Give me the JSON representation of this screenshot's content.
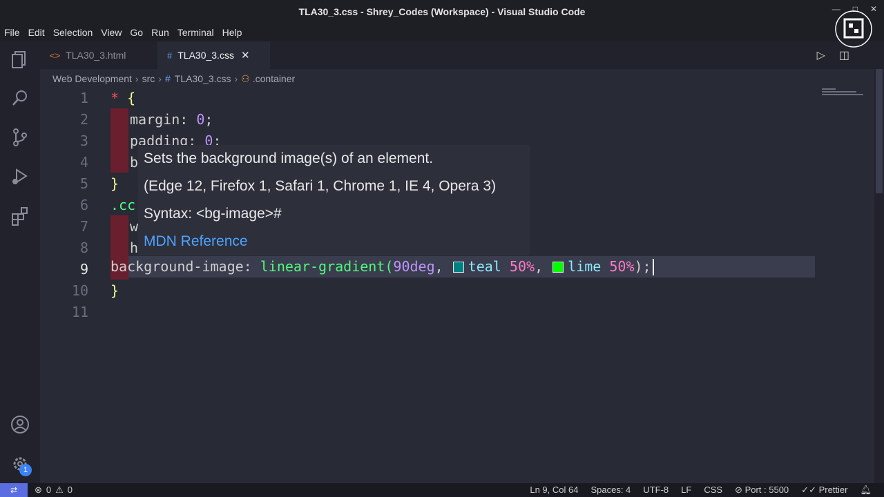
{
  "window": {
    "title": "TLA30_3.css - Shrey_Codes (Workspace) - Visual Studio Code",
    "controls": [
      "—",
      "□",
      "✕"
    ]
  },
  "menu": [
    "File",
    "Edit",
    "Selection",
    "View",
    "Go",
    "Run",
    "Terminal",
    "Help"
  ],
  "tabs": [
    {
      "label": "TLA30_3.html",
      "icon": "html-file-icon",
      "glyph": "<>",
      "active": false
    },
    {
      "label": "TLA30_3.css",
      "icon": "css-file-icon",
      "glyph": "#",
      "active": true
    }
  ],
  "breadcrumb": {
    "parts": [
      "Web Development",
      "src",
      "TLA30_3.css",
      ".container"
    ]
  },
  "editor": {
    "lines": [
      {
        "n": "1",
        "tokens": [
          {
            "t": "* ",
            "c": "kw-sel"
          },
          {
            "t": "{",
            "c": "brace"
          }
        ]
      },
      {
        "n": "2",
        "tokens": [
          {
            "t": "margin: ",
            "c": "prop"
          },
          {
            "t": "0",
            "c": "num"
          },
          {
            "t": ";",
            "c": "prop"
          }
        ]
      },
      {
        "n": "3",
        "tokens": [
          {
            "t": "padding: ",
            "c": "prop"
          },
          {
            "t": "0",
            "c": "num"
          },
          {
            "t": ";",
            "c": "prop"
          }
        ]
      },
      {
        "n": "4",
        "tokens": [
          {
            "t": "b",
            "c": "prop"
          }
        ]
      },
      {
        "n": "5",
        "tokens": [
          {
            "t": "}",
            "c": "brace"
          }
        ]
      },
      {
        "n": "6",
        "tokens": [
          {
            "t": ".cc",
            "c": "fn"
          }
        ]
      },
      {
        "n": "7",
        "tokens": [
          {
            "t": "w",
            "c": "prop"
          }
        ]
      },
      {
        "n": "8",
        "tokens": [
          {
            "t": "h",
            "c": "prop"
          }
        ]
      },
      {
        "n": "9",
        "tokens": []
      },
      {
        "n": "10",
        "tokens": [
          {
            "t": "}",
            "c": "brace"
          }
        ]
      },
      {
        "n": "11",
        "tokens": []
      }
    ],
    "line9": {
      "prop": "background-image: ",
      "fn": "linear-gradient(",
      "arg": "90deg",
      "comma1": ", ",
      "c1": "teal",
      "p1": " 50%",
      "comma2": ", ",
      "c2": "lime",
      "p2": " 50%",
      "end": ");"
    },
    "swatches": {
      "teal": "#008080",
      "lime": "#00ff00"
    }
  },
  "hover": {
    "description": "Sets the background image(s) of an element.",
    "browsers": "(Edge 12, Firefox 1, Safari 1, Chrome 1, IE 4, Opera 3)",
    "syntax": "Syntax: <bg-image>#",
    "link": "MDN Reference"
  },
  "status": {
    "errors": "0",
    "warnings": "0",
    "position": "Ln 9, Col 64",
    "spaces": "Spaces: 4",
    "encoding": "UTF-8",
    "eol": "LF",
    "language": "CSS",
    "port": "Port : 5500",
    "formatter": "Prettier",
    "accounts_badge": "1"
  },
  "colors": {
    "accent": "#5b6ee1",
    "error_mark": "#6a1f2e",
    "link": "#4da3ff"
  }
}
